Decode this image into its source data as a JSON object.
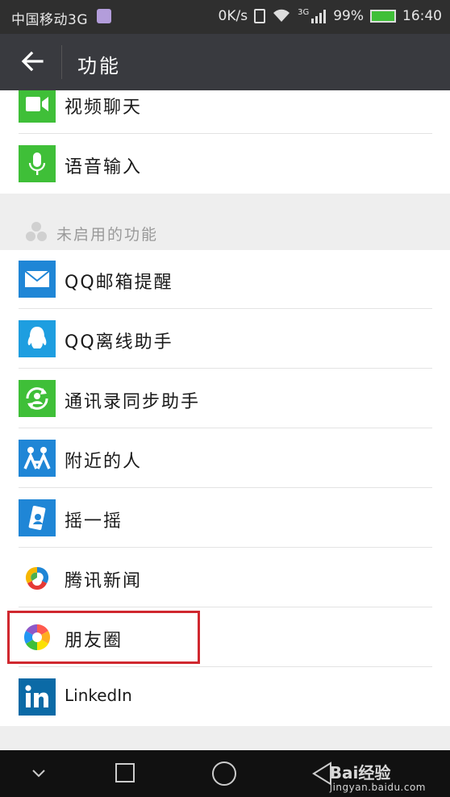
{
  "status_bar": {
    "carrier": "中国移动3G",
    "speed": "0K/s",
    "network": "3G",
    "battery": "99%",
    "time": "16:40"
  },
  "app_bar": {
    "title": "功能",
    "back_icon": "arrow-left-icon"
  },
  "enabled_items": [
    {
      "label": "视频聊天",
      "icon": "video-chat-icon",
      "color": "#3fbf38"
    },
    {
      "label": "语音输入",
      "icon": "microphone-icon",
      "color": "#3fbf38"
    }
  ],
  "disabled_section": {
    "title": "未启用的功能",
    "icon": "groups-icon",
    "items": [
      {
        "label": "QQ邮箱提醒",
        "icon": "mail-icon",
        "color": "#1f86d6"
      },
      {
        "label": "QQ离线助手",
        "icon": "qq-penguin-icon",
        "color": "#1e9ee0"
      },
      {
        "label": "通讯录同步助手",
        "icon": "contacts-sync-icon",
        "color": "#3fbf38"
      },
      {
        "label": "附近的人",
        "icon": "people-nearby-icon",
        "color": "#1f86d6"
      },
      {
        "label": "摇一摇",
        "icon": "shake-phone-icon",
        "color": "#1f86d6"
      },
      {
        "label": "腾讯新闻",
        "icon": "tencent-news-icon",
        "color": "#ffffff"
      },
      {
        "label": "朋友圈",
        "icon": "moments-aperture-icon",
        "color": "#ffffff"
      },
      {
        "label": "LinkedIn",
        "icon": "linkedin-icon",
        "color": "#0b6aa6"
      }
    ]
  },
  "nav_bar": {
    "back_icon": "triangle-back-icon",
    "home_icon": "circle-home-icon",
    "recent_icon": "square-recent-icon",
    "hide_icon": "chevron-down-icon"
  },
  "watermark": {
    "brand": "Bai经验",
    "url": "jingyan.baidu.com"
  }
}
